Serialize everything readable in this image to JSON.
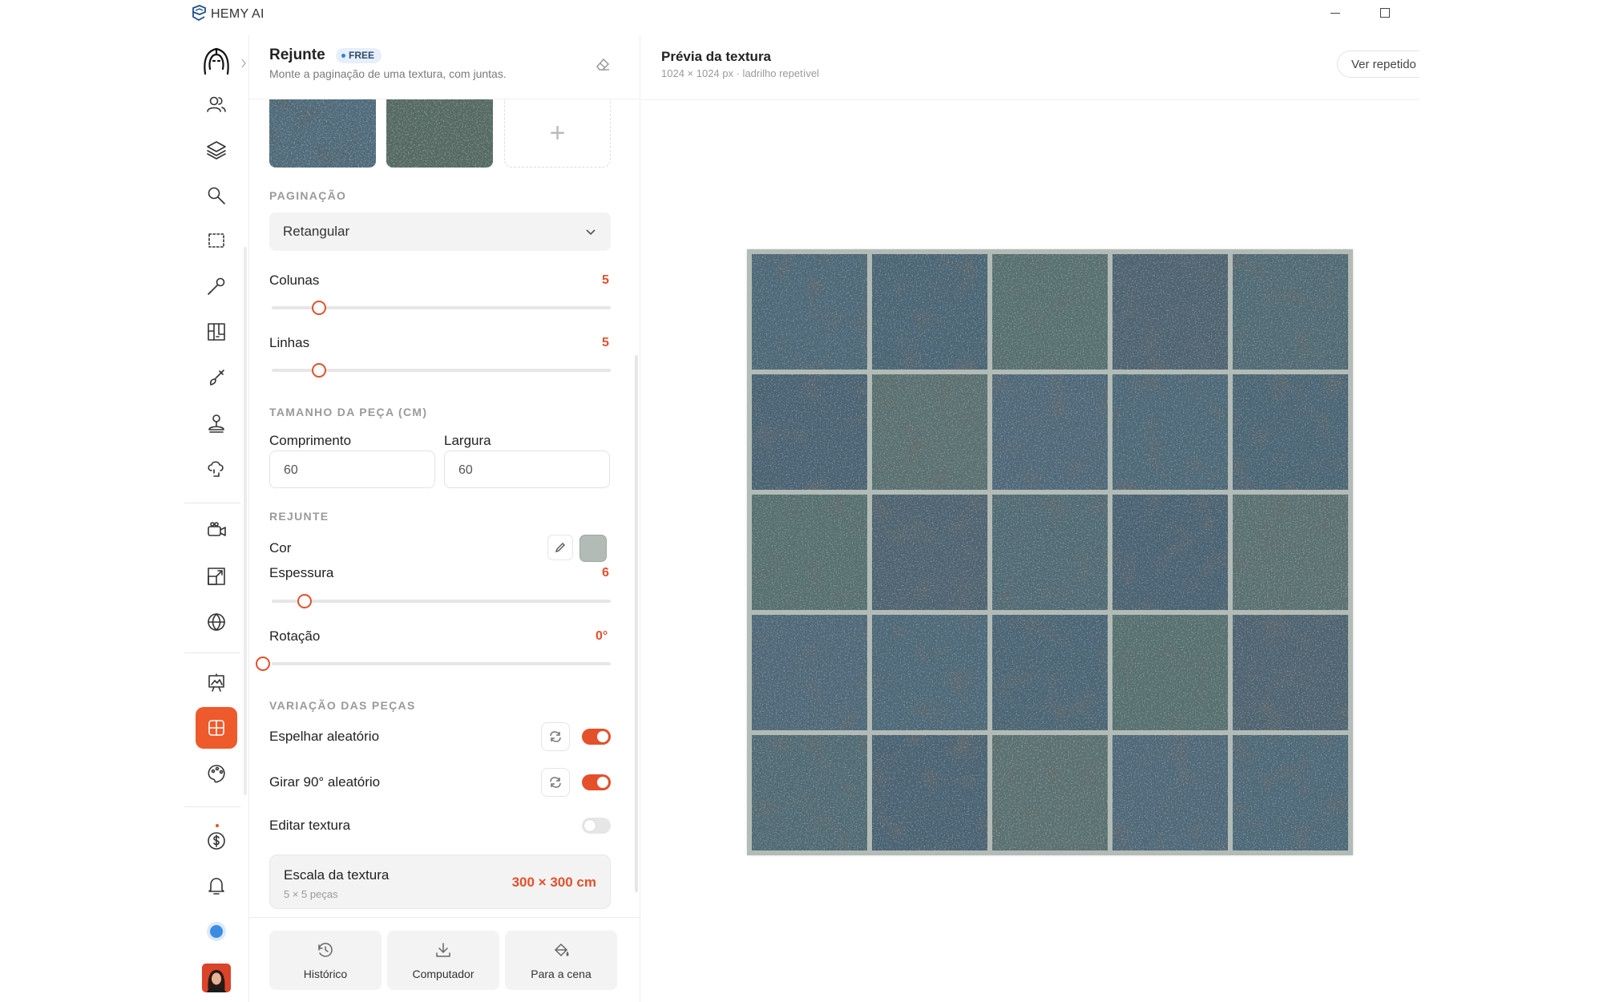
{
  "app": {
    "title": "HEMY AI"
  },
  "panel": {
    "title": "Rejunte",
    "badge": "FREE",
    "subtitle": "Monte a paginação de uma textura, com juntas.",
    "pagination": {
      "section_label": "PAGINAÇÃO",
      "selected": "Retangular"
    },
    "columns": {
      "label": "Colunas",
      "value": "5"
    },
    "rows": {
      "label": "Linhas",
      "value": "5"
    },
    "piece_size": {
      "section_label": "TAMANHO DA PEÇA (CM)",
      "length_label": "Comprimento",
      "length_value": "60",
      "width_label": "Largura",
      "width_value": "60"
    },
    "grout": {
      "section_label": "REJUNTE",
      "color_label": "Cor",
      "color_value": "#b2bbb6",
      "thickness_label": "Espessura",
      "thickness_value": "6",
      "rotation_label": "Rotação",
      "rotation_value": "0°"
    },
    "variation": {
      "section_label": "VARIAÇÃO DAS PEÇAS",
      "mirror_label": "Espelhar aleatório",
      "mirror_on": true,
      "rotate_label": "Girar 90° aleatório",
      "rotate_on": true,
      "edit_label": "Editar textura",
      "edit_on": false
    },
    "scale": {
      "title": "Escala da textura",
      "subtitle": "5 × 5 peças",
      "value": "300 × 300 cm"
    },
    "actions": {
      "history": "Histórico",
      "computer": "Computador",
      "to_scene": "Para a cena"
    }
  },
  "preview": {
    "title": "Prévia da textura",
    "subtitle": "1024 × 1024 px · ladrilho repetível",
    "view_button": "Ver repetido"
  },
  "colors": {
    "accent": "#e4502a",
    "active_tool": "#ee5a2c",
    "grout": "#b2bbb6"
  }
}
